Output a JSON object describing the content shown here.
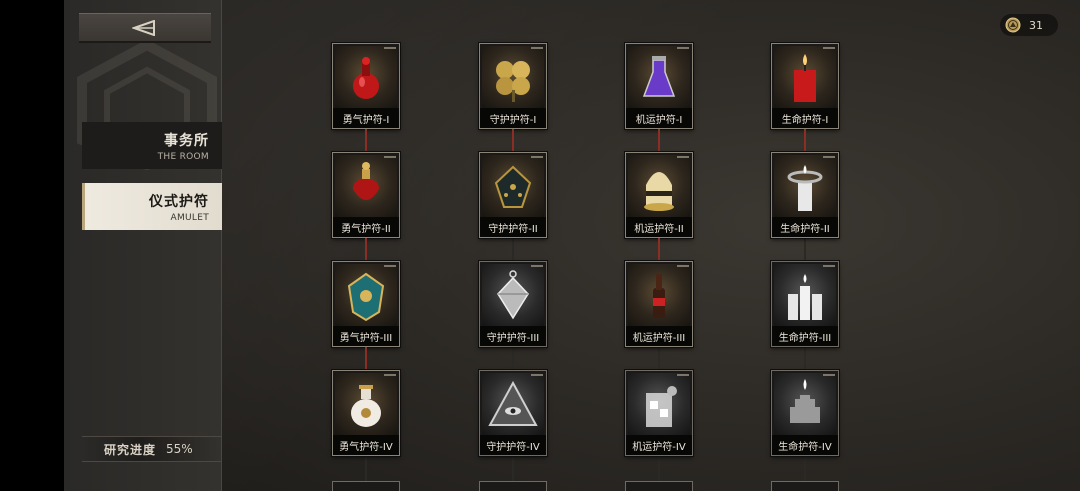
{
  "back_button": {
    "icon": "back-arrow-icon"
  },
  "sidebar": {
    "nav": [
      {
        "cn": "事务所",
        "en": "THE ROOM",
        "active": false
      },
      {
        "cn": "仪式护符",
        "en": "AMULET",
        "active": true
      }
    ],
    "progress": {
      "label": "研究进度",
      "value": "55%"
    }
  },
  "currency": {
    "icon": "coin-icon",
    "count": "31"
  },
  "amulets": {
    "columns": [
      {
        "id": "courage",
        "line_color": "#8a2e26",
        "items": [
          {
            "name": "勇气护符-I",
            "icon": "red-potion-icon",
            "locked": false
          },
          {
            "name": "勇气护符-II",
            "icon": "red-perfume-bottle-icon",
            "locked": false
          },
          {
            "name": "勇气护符-III",
            "icon": "ornate-shield-icon",
            "locked": false
          },
          {
            "name": "勇气护符-IV",
            "icon": "porcelain-vase-icon",
            "locked": false
          }
        ]
      },
      {
        "id": "guard",
        "line_color": "#8a2e26",
        "items": [
          {
            "name": "守护护符-I",
            "icon": "four-leaf-clover-icon",
            "locked": false
          },
          {
            "name": "守护护符-II",
            "icon": "dice-pendant-icon",
            "locked": false
          },
          {
            "name": "守护护符-III",
            "icon": "gem-pendant-icon",
            "locked": true
          },
          {
            "name": "守护护符-IV",
            "icon": "eye-pyramid-icon",
            "locked": true
          }
        ]
      },
      {
        "id": "luck",
        "line_color": "#8a2e26",
        "items": [
          {
            "name": "机运护符-I",
            "icon": "purple-flask-icon",
            "locked": false
          },
          {
            "name": "机运护符-II",
            "icon": "golden-helmet-icon",
            "locked": false
          },
          {
            "name": "机运护符-III",
            "icon": "soda-bottle-icon",
            "locked": false
          },
          {
            "name": "机运护符-IV",
            "icon": "iced-drink-icon",
            "locked": true
          }
        ]
      },
      {
        "id": "life",
        "line_color": "#8a2e26",
        "items": [
          {
            "name": "生命护符-I",
            "icon": "red-candle-icon",
            "locked": false
          },
          {
            "name": "生命护符-II",
            "icon": "white-candle-icon",
            "locked": false
          },
          {
            "name": "生命护符-III",
            "icon": "candle-cluster-icon",
            "locked": true
          },
          {
            "name": "生命护符-IV",
            "icon": "hand-candle-icon",
            "locked": true
          }
        ]
      }
    ]
  },
  "colors": {
    "accent": "#b8a77c",
    "branch_red": "#8a2e26",
    "panel": "#2e2b27"
  }
}
